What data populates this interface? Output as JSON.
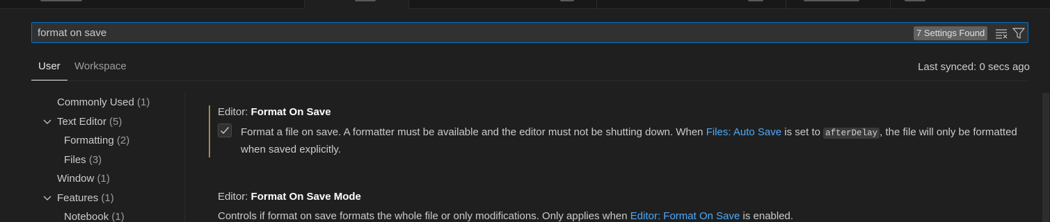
{
  "search": {
    "value": "format on save",
    "results_badge": "7 Settings Found",
    "clear_icon": "clear-filter-icon",
    "filter_icon": "filter-icon"
  },
  "scope_tabs": [
    {
      "label": "User",
      "active": true
    },
    {
      "label": "Workspace",
      "active": false
    }
  ],
  "sync_status": "Last synced: 0 secs ago",
  "toc": [
    {
      "label": "Commonly Used",
      "count": "(1)",
      "level": 0,
      "expanded": null
    },
    {
      "label": "Text Editor",
      "count": "(5)",
      "level": 0,
      "expanded": true
    },
    {
      "label": "Formatting",
      "count": "(2)",
      "level": 1,
      "expanded": null
    },
    {
      "label": "Files",
      "count": "(3)",
      "level": 1,
      "expanded": null
    },
    {
      "label": "Window",
      "count": "(1)",
      "level": 0,
      "expanded": null
    },
    {
      "label": "Features",
      "count": "(1)",
      "level": 0,
      "expanded": true
    },
    {
      "label": "Notebook",
      "count": "(1)",
      "level": 1,
      "expanded": null
    }
  ],
  "settings": [
    {
      "category": "Editor: ",
      "name": "Format On Save",
      "checked": true,
      "modified": true,
      "desc_part1": "Format a file on save. A formatter must be available and the editor must not be shutting down. When ",
      "desc_link": "Files: Auto Save",
      "desc_part2": " is set to ",
      "desc_code": "afterDelay",
      "desc_part3": ", the file will only be formatted when saved explicitly."
    },
    {
      "category": "Editor: ",
      "name": "Format On Save Mode",
      "desc_part1": "Controls if format on save formats the whole file or only modifications. Only applies when ",
      "desc_link": "Editor: Format On Save",
      "desc_part2": " is enabled."
    }
  ],
  "colors": {
    "accent": "#0078d4",
    "link": "#4daafc",
    "modified_indicator": "#e2b76a",
    "background": "#1f1f1f"
  }
}
